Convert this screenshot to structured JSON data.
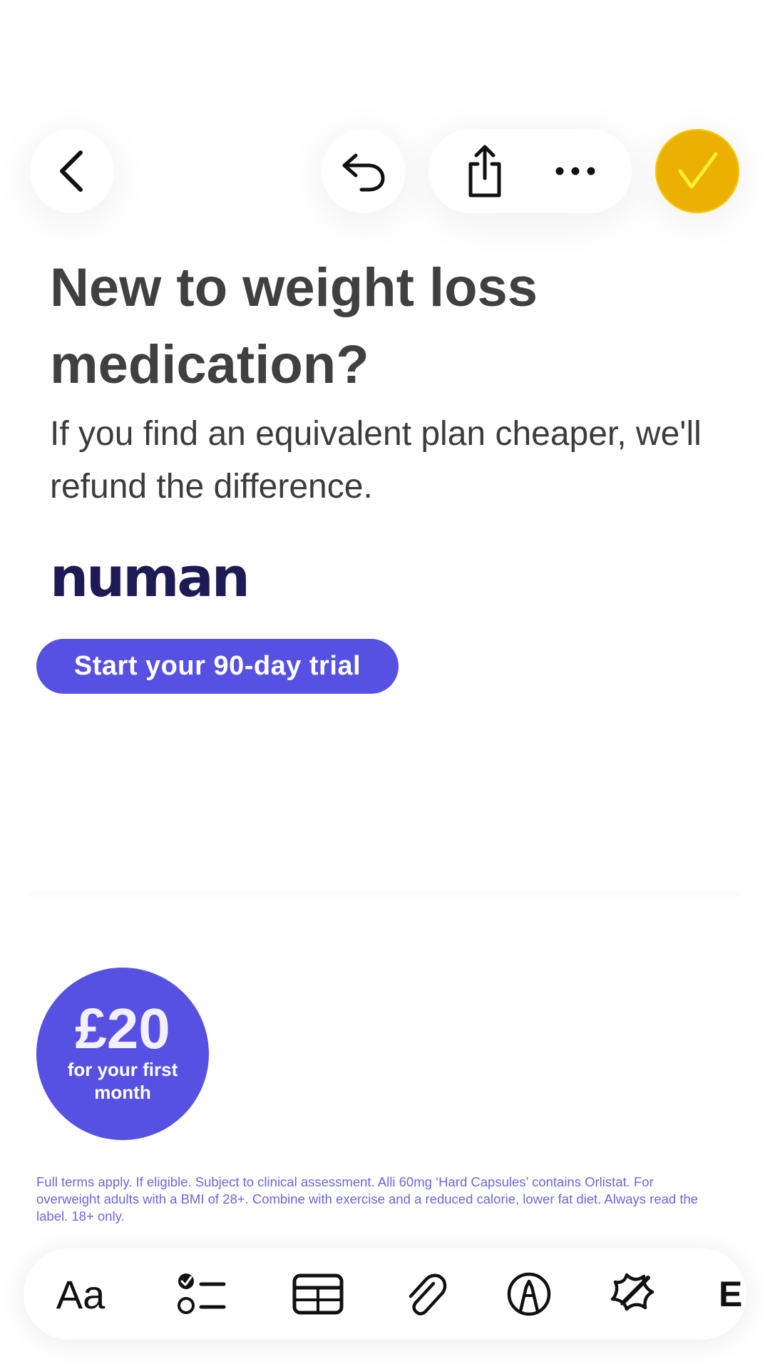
{
  "toolbar": {
    "back_icon": "chevron-left-icon",
    "undo_icon": "undo-arrow-icon",
    "share_icon": "share-icon",
    "more_icon": "ellipsis-icon",
    "done_icon": "checkmark-icon",
    "done_color": "#ecb100"
  },
  "note": {
    "title": "New to weight loss medication?",
    "subtitle": "If you find an equivalent plan cheaper, we'll refund the difference."
  },
  "ad": {
    "brand": "numan",
    "brand_color": "#1e1a55",
    "accent_color": "#5651e2",
    "cta_label": "Start your 90-day trial",
    "price_amount": "£20",
    "price_caption": "for your first month",
    "disclaimer": "Full terms apply. If eligible. Subject to clinical assessment. Alli 60mg ‘Hard Capsules’ contains Orlistat. For overweight adults with a BMI of 28+. Combine with exercise and a reduced calorie, lower fat diet. Always read the label. 18+ only."
  },
  "format_bar": {
    "text_format_label": "Aa",
    "checklist_icon": "checklist-icon",
    "table_icon": "table-icon",
    "attachment_icon": "paperclip-icon",
    "markup_icon": "pen-circle-icon",
    "ai_icon": "sparkle-pencil-icon",
    "more_label": "E"
  }
}
